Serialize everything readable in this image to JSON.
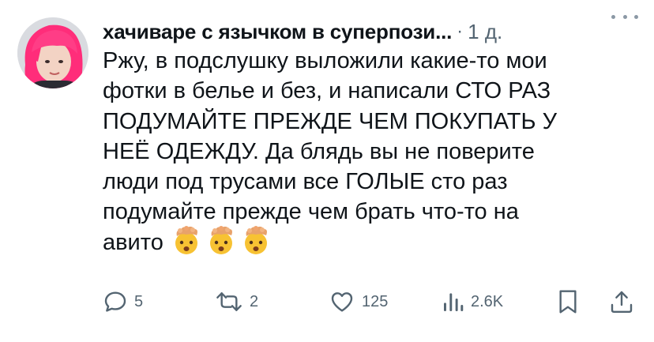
{
  "post": {
    "author_name": "хачиваре с язычком в суперпози...",
    "separator": "·",
    "timestamp": "1 д.",
    "text_lines": [
      "Ржу, в подслушку выложили какие-то мои",
      "фотки в белье и без, и написали СТО РАЗ",
      "ПОДУМАЙТЕ ПРЕЖДЕ ЧЕМ ПОКУПАТЬ У",
      "НЕЁ ОДЕЖДУ. Да блядь вы не поверите",
      "люди под трусами все ГОЛЫЕ сто раз",
      "подумайте прежде чем брать что-то на",
      "авито"
    ],
    "emojis": [
      "exploding-head",
      "exploding-head",
      "exploding-head"
    ]
  },
  "actions": {
    "replies": "5",
    "reposts": "2",
    "likes": "125",
    "views": "2.6K"
  },
  "icons": {
    "reply": "reply-icon",
    "repost": "repost-icon",
    "like": "heart-icon",
    "views": "views-icon",
    "bookmark": "bookmark-icon",
    "share": "share-icon",
    "more": "more-icon"
  },
  "colors": {
    "text": "#0f1419",
    "secondary": "#536471",
    "avatar_hair": "#ff2d7a"
  }
}
